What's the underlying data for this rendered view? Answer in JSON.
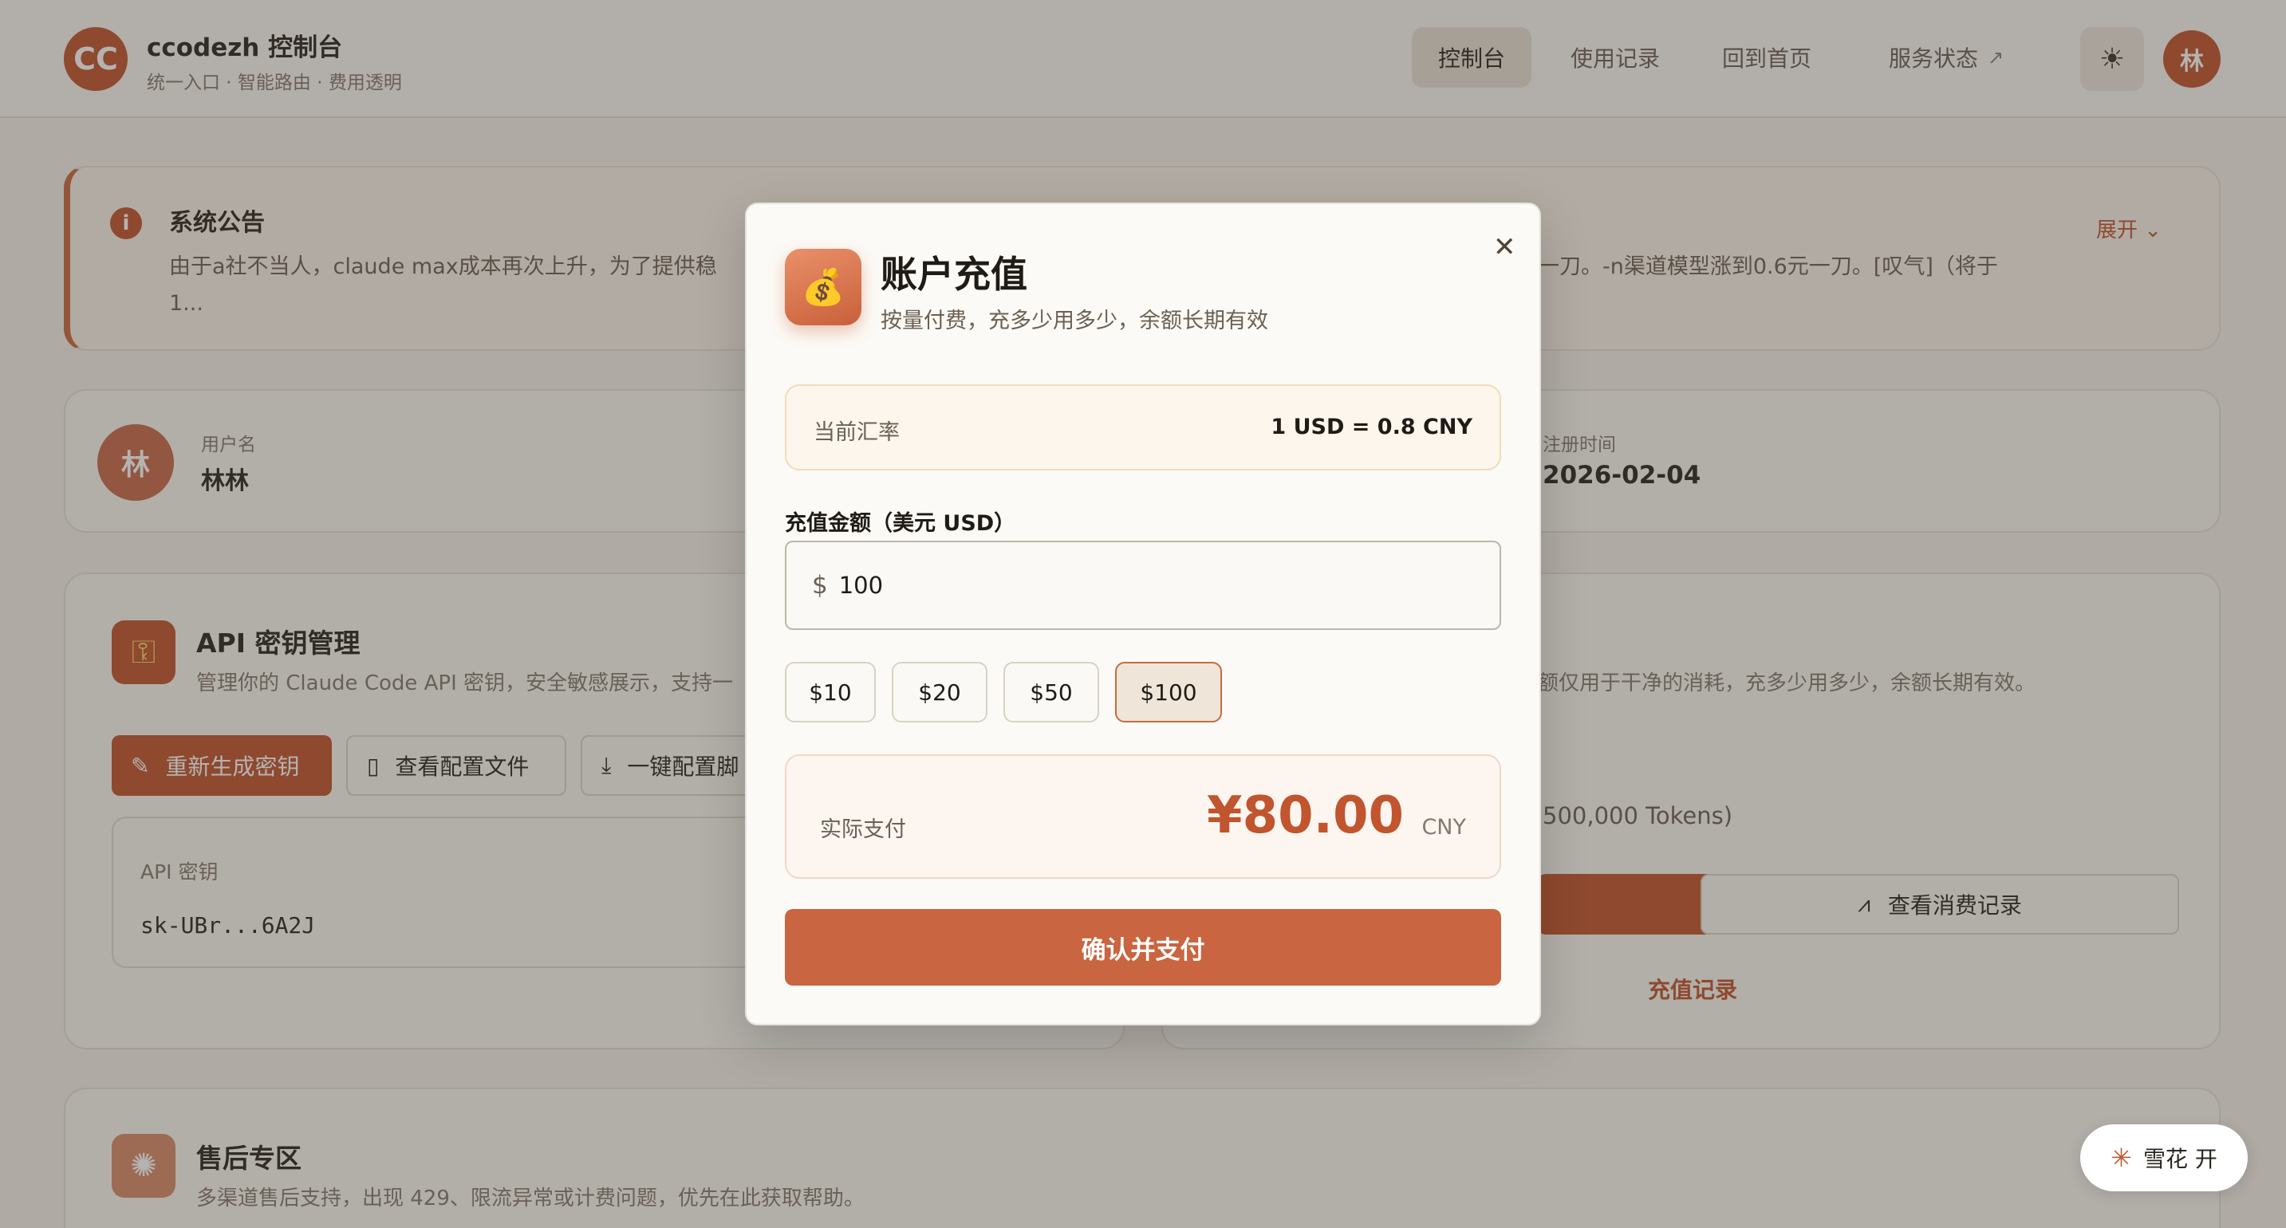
{
  "header": {
    "logo": "CC",
    "title": "ccodezh 控制台",
    "subtitle": "统一入口 · 智能路由 · 费用透明",
    "nav": [
      "控制台",
      "使用记录",
      "回到首页",
      "服务状态"
    ],
    "theme_icon": "sun-icon",
    "avatar": "林"
  },
  "notice": {
    "title": "系统公告",
    "text_left": "由于a社不当人，claude max成本再次上升，为了提供稳",
    "text_left_tail": "1...",
    "text_right": "一刀。-n渠道模型涨到0.6元一刀。[叹气]（将于",
    "expand": "展开"
  },
  "user": {
    "avatar": "林",
    "username_label": "用户名",
    "username": "林林",
    "reg_label": "注册时间",
    "reg_date": "2026-02-04"
  },
  "api": {
    "title": "API 密钥管理",
    "desc": "管理你的 Claude Code API 密钥，安全敏感展示，支持一",
    "regen": "重新生成密钥",
    "view_config": "查看配置文件",
    "one_click": "一键配置脚",
    "key_label": "API 密钥",
    "key_value": "sk-UBr...6A2J"
  },
  "balance": {
    "desc": "额仅用于干净的消耗，充多少用多少，余额长期有效。",
    "tokens": "500,000 Tokens)",
    "history": "查看消费记录",
    "recharge_link": "充值记录"
  },
  "after_sales": {
    "title": "售后专区",
    "desc": "多渠道售后支持，出现 429、限流异常或计费问题，优先在此获取帮助。"
  },
  "snow": "雪花 开",
  "modal": {
    "title": "账户充值",
    "subtitle": "按量付费，充多少用多少，余额长期有效",
    "rate_label": "当前汇率",
    "rate_value": "1 USD = 0.8 CNY",
    "amount_label": "充值金额（美元 USD）",
    "currency_symbol": "$",
    "amount_value": "100",
    "presets": [
      "$10",
      "$20",
      "$50",
      "$100"
    ],
    "selected_preset": "$100",
    "pay_label": "实际支付",
    "pay_amount": "¥80.00",
    "pay_currency": "CNY",
    "confirm": "确认并支付"
  },
  "colors": {
    "accent": "#c0552e",
    "background": "#f5f0e9"
  }
}
